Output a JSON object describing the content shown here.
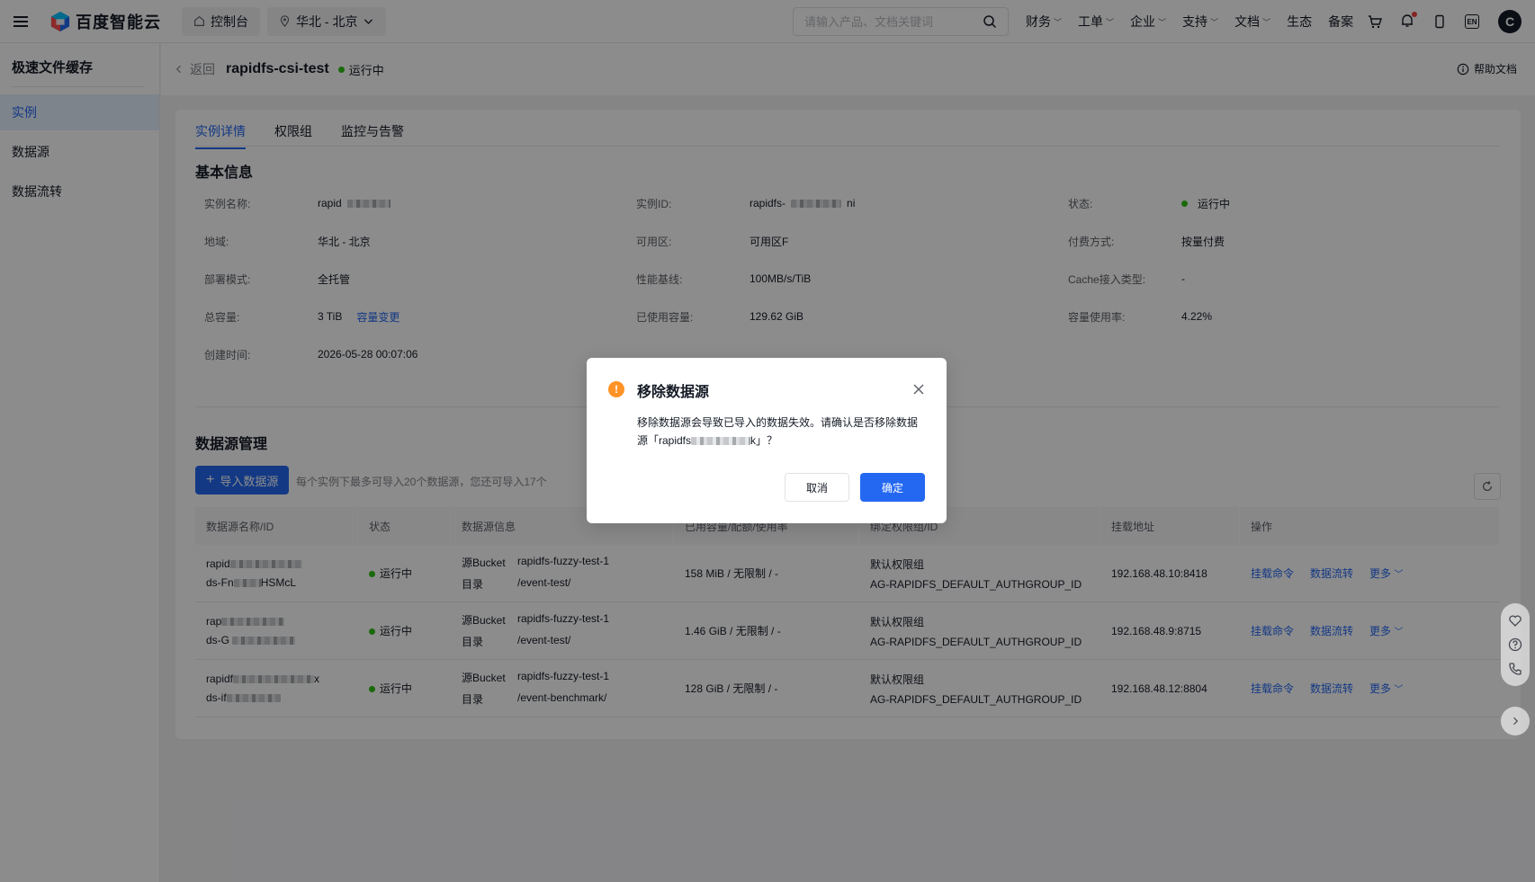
{
  "topbar": {
    "brand": "百度智能云",
    "console_label": "控制台",
    "region_label": "华北 - 北京",
    "search_placeholder": "请输入产品、文档关键词",
    "nav": [
      {
        "label": "财务",
        "has_dropdown": true
      },
      {
        "label": "工单",
        "has_dropdown": true
      },
      {
        "label": "企业",
        "has_dropdown": true
      },
      {
        "label": "支持",
        "has_dropdown": true
      },
      {
        "label": "文档",
        "has_dropdown": true
      },
      {
        "label": "生态",
        "has_dropdown": false
      },
      {
        "label": "备案",
        "has_dropdown": false
      }
    ],
    "lang_icon": "EN",
    "avatar_letter": "C"
  },
  "sidebar": {
    "title": "极速文件缓存",
    "items": [
      {
        "label": "实例",
        "active": true
      },
      {
        "label": "数据源",
        "active": false
      },
      {
        "label": "数据流转",
        "active": false
      }
    ]
  },
  "header": {
    "back_label": "返回",
    "instance_name": "rapidfs-csi-test",
    "status": "运行中",
    "help_label": "帮助文档"
  },
  "tabs": [
    {
      "label": "实例详情",
      "active": true
    },
    {
      "label": "权限组",
      "active": false
    },
    {
      "label": "监控与告警",
      "active": false
    }
  ],
  "basic_info": {
    "title": "基本信息",
    "rows": [
      [
        {
          "label": "实例名称:",
          "value": "rapid",
          "blurred": true
        },
        {
          "label": "实例ID:",
          "value": "rapidfs-",
          "suffix": "ni",
          "blurred": true
        },
        {
          "label": "状态:",
          "value": "运行中",
          "status": true
        }
      ],
      [
        {
          "label": "地域:",
          "value": "华北 - 北京"
        },
        {
          "label": "可用区:",
          "value": "可用区F"
        },
        {
          "label": "付费方式:",
          "value": "按量付费"
        }
      ],
      [
        {
          "label": "部署模式:",
          "value": "全托管"
        },
        {
          "label": "性能基线:",
          "value": "100MB/s/TiB"
        },
        {
          "label": "Cache接入类型:",
          "value": "-"
        }
      ],
      [
        {
          "label": "总容量:",
          "value": "3 TiB",
          "link": "容量变更"
        },
        {
          "label": "已使用容量:",
          "value": "129.62 GiB"
        },
        {
          "label": "容量使用率:",
          "value": "4.22%"
        }
      ],
      [
        {
          "label": "创建时间:",
          "value": "2026-05-28 00:07:06"
        }
      ]
    ]
  },
  "datasource": {
    "title": "数据源管理",
    "import_label": "导入数据源",
    "import_tip": "每个实例下最多可导入20个数据源，您还可导入17个",
    "columns": [
      "数据源名称/ID",
      "状态",
      "数据源信息",
      "已用容量/配额/使用率",
      "绑定权限组/ID",
      "挂载地址",
      "操作"
    ],
    "rows": [
      {
        "name": "rapid",
        "id": "ds-Fn",
        "id_suffix": "HSMcL",
        "status": "运行中",
        "bucket_label": "源Bucket",
        "bucket": "rapidfs-fuzzy-test-1",
        "dir_label": "目录",
        "dir": "/event-test/",
        "usage": "158 MiB / 无限制 / -",
        "group": "默认权限组",
        "group_id": "AG-RAPIDFS_DEFAULT_AUTHGROUP_ID",
        "mount": "192.168.48.10:8418"
      },
      {
        "name": "rap",
        "id": "ds-G",
        "id_suffix": "",
        "status": "运行中",
        "bucket_label": "源Bucket",
        "bucket": "rapidfs-fuzzy-test-1",
        "dir_label": "目录",
        "dir": "/event-test/",
        "usage": "1.46 GiB / 无限制 / -",
        "group": "默认权限组",
        "group_id": "AG-RAPIDFS_DEFAULT_AUTHGROUP_ID",
        "mount": "192.168.48.9:8715"
      },
      {
        "name": "rapidf",
        "name_suffix": "x",
        "id": "ds-if",
        "id_suffix": "",
        "status": "运行中",
        "bucket_label": "源Bucket",
        "bucket": "rapidfs-fuzzy-test-1",
        "dir_label": "目录",
        "dir": "/event-benchmark/",
        "usage": "128 GiB / 无限制 / -",
        "group": "默认权限组",
        "group_id": "AG-RAPIDFS_DEFAULT_AUTHGROUP_ID",
        "mount": "192.168.48.12:8804"
      }
    ],
    "ops": {
      "mount_cmd": "挂载命令",
      "flow": "数据流转",
      "more": "更多"
    }
  },
  "dialog": {
    "title": "移除数据源",
    "body_prefix": "移除数据源会导致已导入的数据失效。请确认是否移除数据源「rapidfs",
    "body_suffix": "k」？",
    "cancel_label": "取消",
    "confirm_label": "确定"
  },
  "colors": {
    "primary": "#2468f2",
    "success": "#30bf13",
    "warning": "#ff9326",
    "text": "#151b26"
  }
}
